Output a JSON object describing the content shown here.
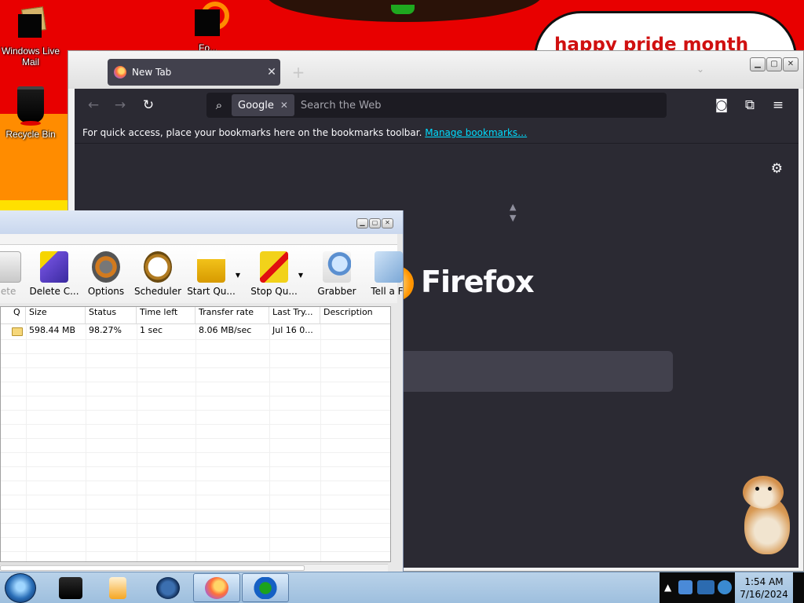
{
  "desktop": {
    "banner_text": "happy pride month",
    "icons": [
      {
        "label": "Windows Live Mail",
        "icon": "mail-icon"
      },
      {
        "label": "Recycle Bin",
        "icon": "recycle-bin-icon"
      },
      {
        "label": "Fo...",
        "icon": "app-icon"
      }
    ]
  },
  "firefox": {
    "tab": {
      "title": "New Tab",
      "close": "✕",
      "favicon": "firefox-icon"
    },
    "new_tab": "+",
    "list_tabs": "⌄",
    "window_controls": {
      "minimize": "▁",
      "maximize": "▢",
      "close": "✕"
    },
    "nav": {
      "back": "←",
      "forward": "→",
      "reload": "↻"
    },
    "urlbar": {
      "search_icon": "⌕",
      "engine": "Google",
      "engine_remove": "✕",
      "placeholder": "Search the Web"
    },
    "toolbar_icons": {
      "pocket": "◙",
      "extensions": "⧉",
      "menu": "≡"
    },
    "bookmarks_bar": {
      "text": "For quick access, place your bookmarks here on the bookmarks toolbar.",
      "link": "Manage bookmarks…"
    },
    "gear": "⚙",
    "updown": "▲▼",
    "brand": "Firefox"
  },
  "idm": {
    "window_controls": {
      "minimize": "▁",
      "maximize": "▢",
      "close": "✕"
    },
    "toolbar": [
      {
        "label": "lete",
        "icon": "delete-icon",
        "dim": true
      },
      {
        "label": "Delete C...",
        "icon": "delete-completed-icon"
      },
      {
        "label": "Options",
        "icon": "options-gear-icon"
      },
      {
        "label": "Scheduler",
        "icon": "alarm-clock-icon"
      },
      {
        "label": "Start Qu...",
        "icon": "start-queue-icon",
        "arrow": "▼"
      },
      {
        "label": "Stop Qu...",
        "icon": "stop-queue-icon",
        "arrow": "▼"
      },
      {
        "label": "Grabber",
        "icon": "grabber-icon"
      },
      {
        "label": "Tell a Fr",
        "icon": "tell-friend-icon"
      }
    ],
    "columns": [
      "Q",
      "Size",
      "Status",
      "Time left",
      "Transfer rate",
      "Last Try...",
      "Description"
    ],
    "rows": [
      {
        "q": "",
        "size": "598.44 MB",
        "status": "98.27%",
        "time_left": "1 sec",
        "rate": "8.06 MB/sec",
        "last_try": "Jul 16 0...",
        "description": ""
      }
    ]
  },
  "taskbar": {
    "apps": [
      {
        "name": "folder-app",
        "active": false
      },
      {
        "name": "media-player-app",
        "active": false
      },
      {
        "name": "media-center-app",
        "active": false
      },
      {
        "name": "firefox-app",
        "active": true
      },
      {
        "name": "idm-app",
        "active": true
      }
    ],
    "tray_arrow": "▲",
    "time": "1:54 AM",
    "date": "7/16/2024"
  },
  "colors": {
    "firefox_bg": "#2b2a33",
    "firefox_tab": "#42414d",
    "link": "#00ddff",
    "desktop_red": "#e80000"
  }
}
